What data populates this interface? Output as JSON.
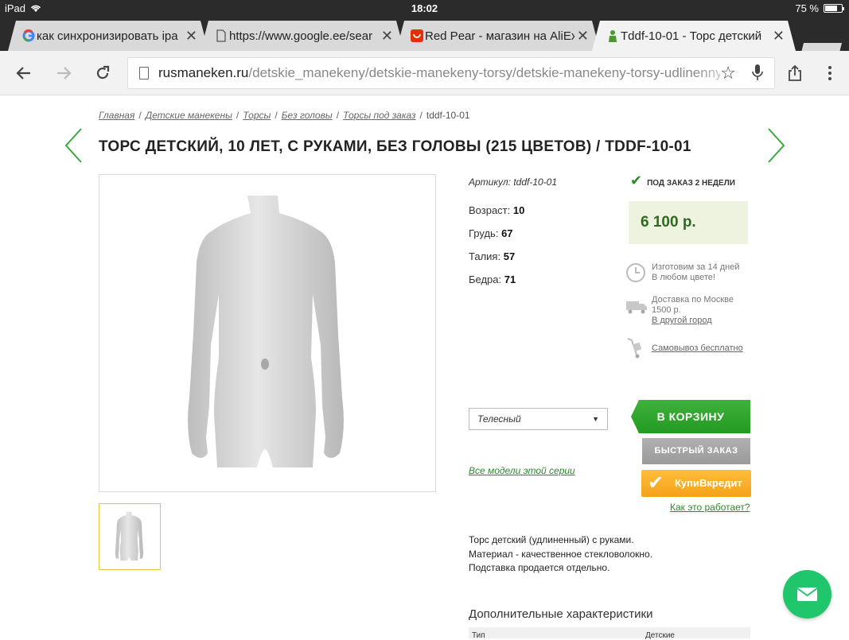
{
  "status_bar": {
    "device": "iPad",
    "time": "18:02",
    "battery": "75 %",
    "battery_level": 0.75
  },
  "tabs": [
    {
      "title": "как синхронизировать ipa",
      "favicon": "google-g-icon"
    },
    {
      "title": "https://www.google.ee/sear",
      "favicon": "page-icon"
    },
    {
      "title": "Red Pear - магазин на AliEx",
      "favicon": "aliexpress-icon"
    },
    {
      "title": "Tddf-10-01 - Торс детский",
      "favicon": "mannequin-icon",
      "active": true
    }
  ],
  "omnibox": {
    "host": "rusmaneken.ru",
    "path": "/detskie_manekeny/detskie-manekeny-torsy/detskie-manekeny-torsy-udlinenny"
  },
  "breadcrumb": [
    "Главная",
    "Детские манекены",
    "Торсы",
    "Без головы",
    "Торсы под заказ"
  ],
  "breadcrumb_current": "tddf-10-01",
  "title": "ТОРС ДЕТСКИЙ, 10 ЛЕТ, С РУКАМИ, БЕЗ ГОЛОВЫ (215 ЦВЕТОВ) / TDDF-10-01",
  "sku": "Артикул: tddf-10-01",
  "specs": [
    {
      "label": "Возраст:",
      "value": "10"
    },
    {
      "label": "Грудь:",
      "value": "67"
    },
    {
      "label": "Талия:",
      "value": "57"
    },
    {
      "label": "Бедра:",
      "value": "71"
    }
  ],
  "availability": "ПОД ЗАКАЗ 2 НЕДЕЛИ",
  "price": "6 100 р.",
  "info": {
    "production_line1": "Изготовим за 14 дней",
    "production_line2": "В любом цвете!",
    "delivery_line1": "Доставка по Москве",
    "delivery_line2": "1500 р.",
    "delivery_link": "В другой город",
    "pickup": "Самовывоз бесплатно"
  },
  "color_select": "Телесный",
  "series_link": "Все модели этой серии",
  "buttons": {
    "cart": "В КОРЗИНУ",
    "quick": "БЫСТРЫЙ ЗАКАЗ",
    "credit": "КупиВкредит",
    "how": "Как это работает?"
  },
  "description": [
    "Торс детский (удлиненный) с руками.",
    "Материал - качественное стекловолокно.",
    "Подставка продается отдельно."
  ],
  "extra": {
    "title": "Дополнительные характеристики",
    "col1": "Тип",
    "col2": "Детские"
  },
  "colors": {
    "accent_green": "#2c8a2c",
    "cart_green": "#2fa72d",
    "price_bg": "#eef3df",
    "credit_orange": "#f7a91f",
    "fab_green": "#1fc66b"
  }
}
